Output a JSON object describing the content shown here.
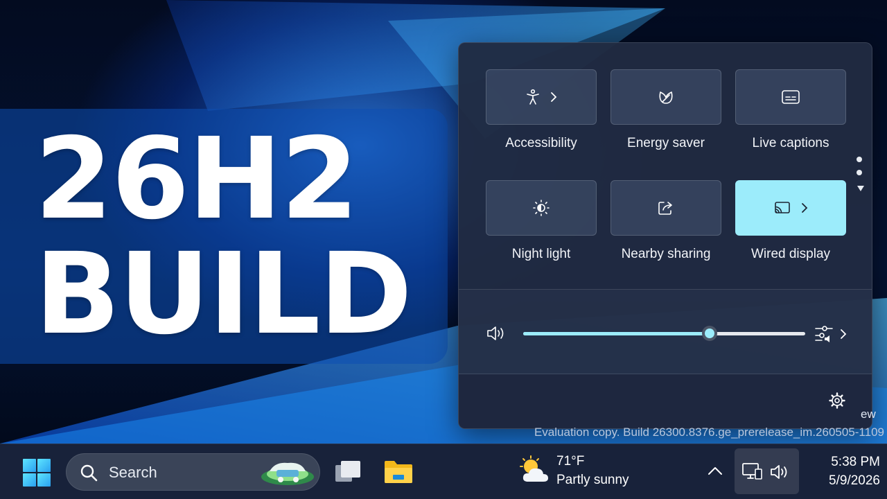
{
  "title_card": {
    "line1": "26H2",
    "line2": "BUILD"
  },
  "quick_settings": {
    "tiles": [
      {
        "label": "Accessibility",
        "icon": "accessibility-icon",
        "has_chevron": true,
        "active": false
      },
      {
        "label": "Energy saver",
        "icon": "leaf-icon",
        "has_chevron": false,
        "active": false
      },
      {
        "label": "Live captions",
        "icon": "captions-icon",
        "has_chevron": false,
        "active": false
      },
      {
        "label": "Night light",
        "icon": "brightness-icon",
        "has_chevron": false,
        "active": false
      },
      {
        "label": "Nearby sharing",
        "icon": "share-icon",
        "has_chevron": false,
        "active": false
      },
      {
        "label": "Wired display",
        "icon": "cast-icon",
        "has_chevron": true,
        "active": true
      }
    ],
    "pager_icons": [
      "dot",
      "dot",
      "arrow-down-icon"
    ],
    "volume": {
      "level": 0.66,
      "icon": "speaker-icon",
      "mixer_icon": "sound-mixer-icon"
    },
    "settings_icon": "gear-icon",
    "active_color": "#9cecfb"
  },
  "watermark": {
    "line1_partial": "ew",
    "line2": "Evaluation copy. Build 26300.8376.ge_prerelease_im.260505-1109"
  },
  "taskbar": {
    "search_label": "Search",
    "pinned_apps": [
      "task-view-icon",
      "file-explorer-icon"
    ],
    "weather": {
      "temp": "71°F",
      "condition": "Partly sunny",
      "icon": "partly-sunny-icon"
    },
    "clock": {
      "time": "5:38 PM",
      "date": "5/9/2026"
    }
  }
}
